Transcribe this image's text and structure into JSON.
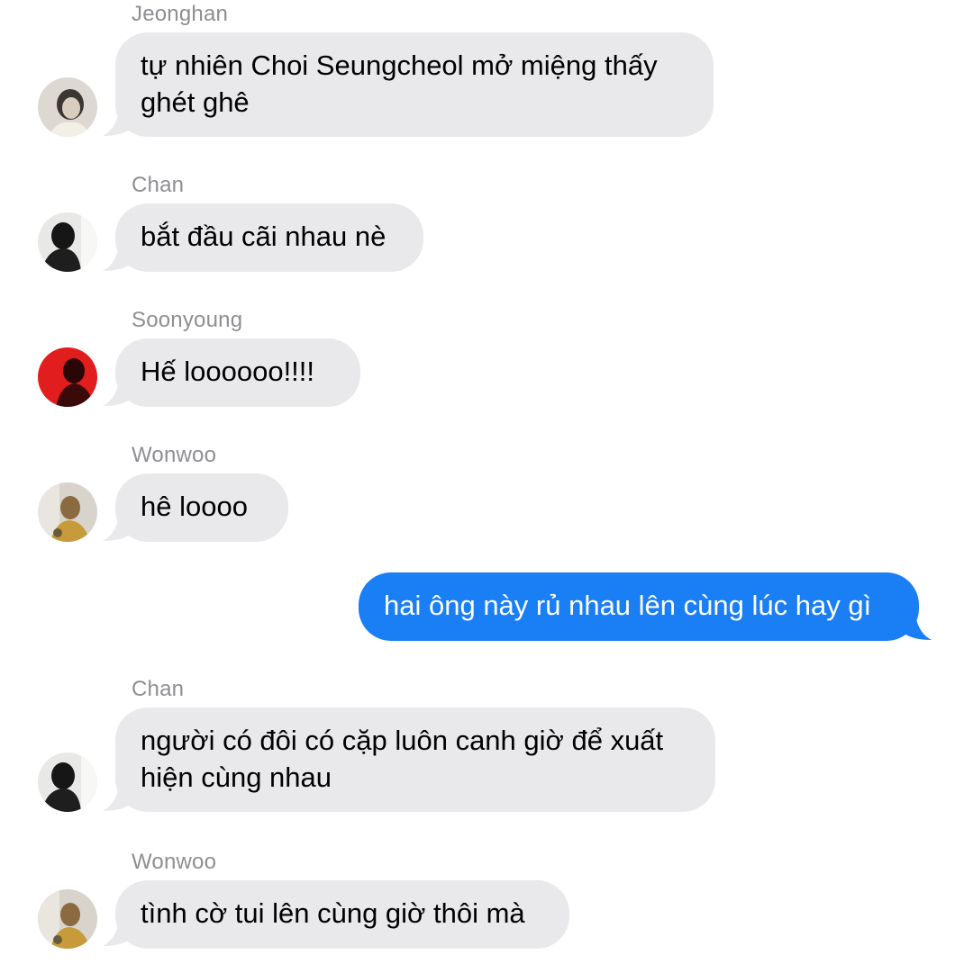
{
  "messages": [
    {
      "sender": "Jeonghan",
      "text": "tự nhiên Choi Seungcheol mở miệng thấy ghét ghê"
    },
    {
      "sender": "Chan",
      "text": "bắt đầu cãi nhau nè"
    },
    {
      "sender": "Soonyoung",
      "text": "Hế loooooo!!!!"
    },
    {
      "sender": "Wonwoo",
      "text": "hê loooo"
    },
    {
      "sender": "me",
      "text": "hai ông này rủ nhau lên cùng lúc hay gì"
    },
    {
      "sender": "Chan",
      "text": "người có đôi có cặp luôn canh giờ để xuất hiện cùng nhau"
    },
    {
      "sender": "Wonwoo",
      "text": "tình cờ tui lên cùng giờ thôi mà"
    }
  ],
  "colors": {
    "incoming_bubble": "#e9e9eb",
    "outgoing_bubble": "#1a7ef5",
    "sender_name": "#8e8e93"
  }
}
